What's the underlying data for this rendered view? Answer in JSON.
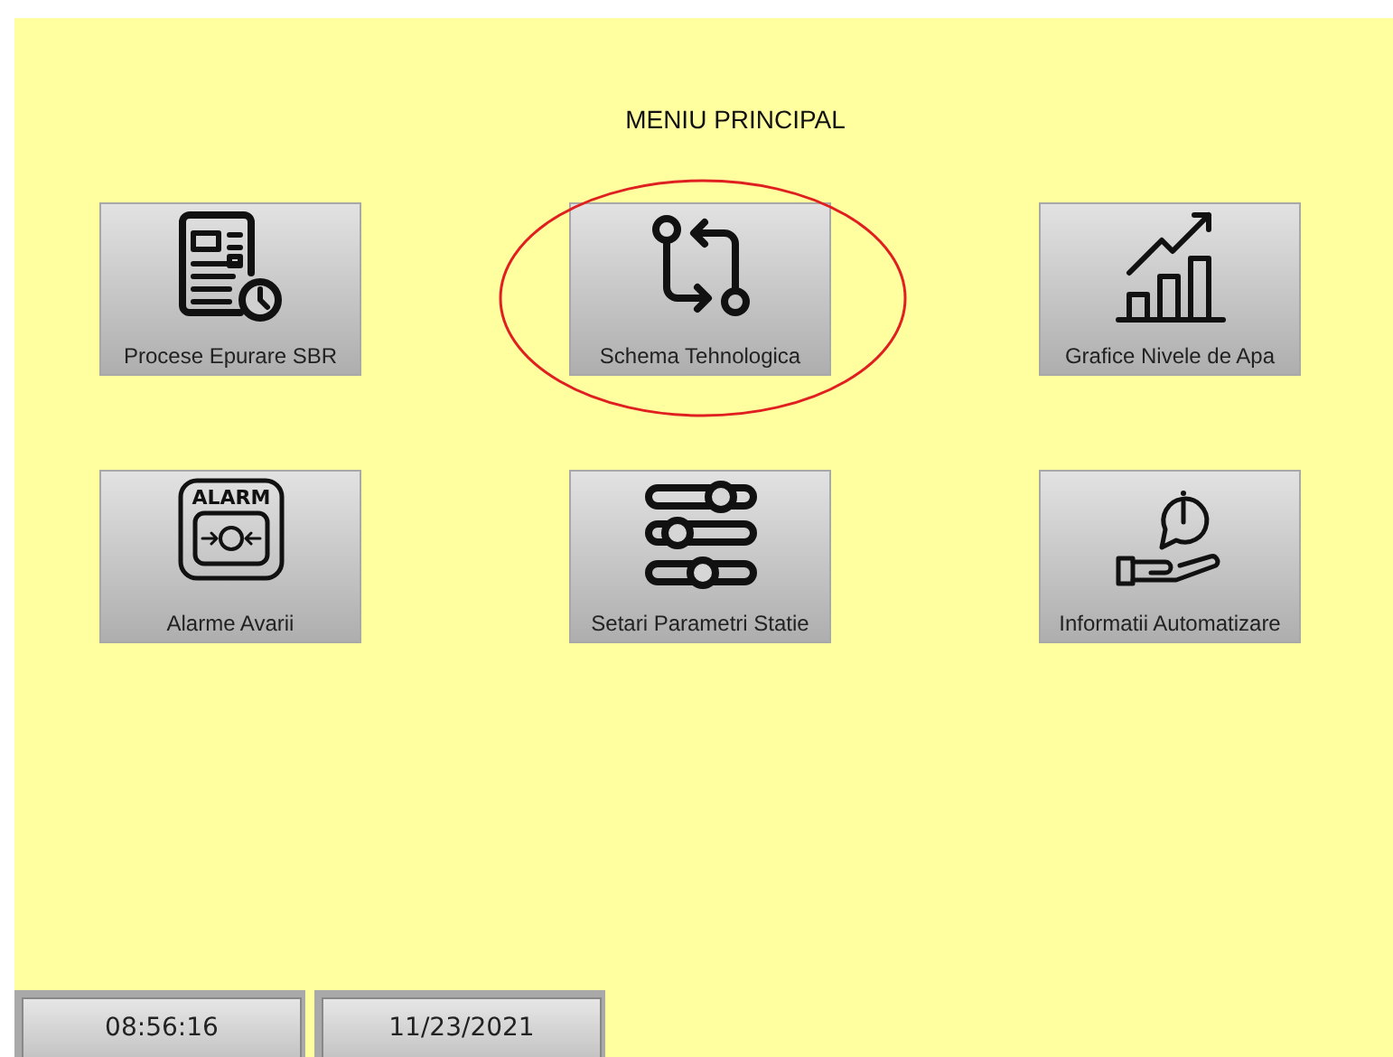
{
  "title": "MENIU PRINCIPAL",
  "menu": [
    {
      "kind": "report",
      "label": "Procese Epurare SBR",
      "highlighted": false
    },
    {
      "kind": "flow",
      "label": "Schema Tehnologica",
      "highlighted": true
    },
    {
      "kind": "chart",
      "label": "Grafice Nivele de Apa",
      "highlighted": false
    },
    {
      "kind": "alarm",
      "label": "Alarme Avarii",
      "icon_text": "ALARM",
      "highlighted": false
    },
    {
      "kind": "sliders",
      "label": "Setari Parametri Statie",
      "highlighted": false
    },
    {
      "kind": "info",
      "label": "Informatii Automatizare",
      "highlighted": false
    }
  ],
  "status_bar": {
    "time": "08:56:16",
    "date": "11/23/2021"
  }
}
